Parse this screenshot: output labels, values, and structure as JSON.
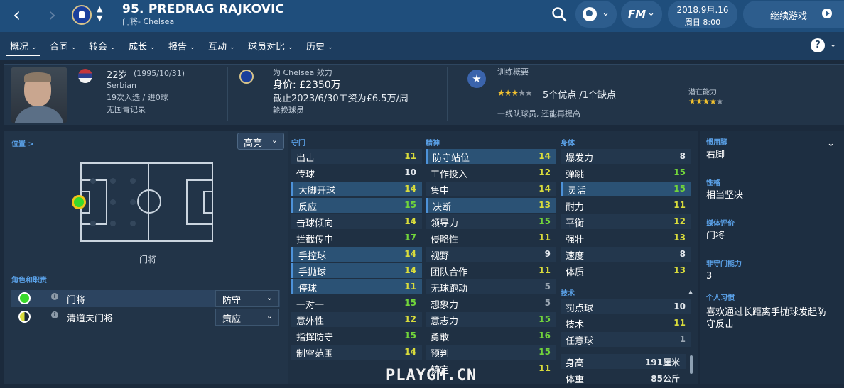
{
  "topbar": {
    "player_name": "95. PREDRAG RAJKOVIC",
    "subtitle": "门将- Chelsea",
    "date_line1": "2018.9月.16",
    "date_line2": "周日 8:00",
    "fm_label": "FM",
    "continue_label": "继续游戏"
  },
  "menu": [
    {
      "label": "概况"
    },
    {
      "label": "合同"
    },
    {
      "label": "转会"
    },
    {
      "label": "成长"
    },
    {
      "label": "报告"
    },
    {
      "label": "互动"
    },
    {
      "label": "球员对比"
    },
    {
      "label": "历史"
    }
  ],
  "info": {
    "age": "22岁",
    "dob": "(1995/10/31)",
    "nationality": "Serbian",
    "caps": "19次入选 / 进0球",
    "youth": "无国青记录",
    "plays_for": "为 Chelsea 效力",
    "value": "身价: £2350万",
    "contract": "截止2023/6/30工资为£6.5万/周",
    "squad_status": "轮换球员",
    "training_title": "训练概要",
    "strengths": "5个优点 /1个缺点",
    "training_note": "一线队球员, 还能再提高",
    "potential_title": "潜在能力",
    "current_stars": 3,
    "potential_stars": 4
  },
  "left": {
    "position_title": "位置 >",
    "highlight_label": "高亮",
    "pitch_label": "门将",
    "roles_title": "角色和职责",
    "roles": [
      {
        "name": "门将",
        "duty": "防守",
        "color": "#39d92b"
      },
      {
        "name": "清道夫门将",
        "duty": "策应",
        "color": "#d9dc3c"
      }
    ]
  },
  "sections": {
    "goalkeeping": "守门",
    "mental": "精神",
    "physical": "身体",
    "technical": "技术"
  },
  "goalkeeping": [
    {
      "label": "出击",
      "value": "11"
    },
    {
      "label": "传球",
      "value": "10"
    },
    {
      "label": "大脚开球",
      "value": "14"
    },
    {
      "label": "反应",
      "value": "15"
    },
    {
      "label": "击球倾向",
      "value": "14"
    },
    {
      "label": "拦截传中",
      "value": "17"
    },
    {
      "label": "手控球",
      "value": "14"
    },
    {
      "label": "手抛球",
      "value": "14"
    },
    {
      "label": "停球",
      "value": "11"
    },
    {
      "label": "一对一",
      "value": "15"
    },
    {
      "label": "意外性",
      "value": "12"
    },
    {
      "label": "指挥防守",
      "value": "15"
    },
    {
      "label": "制空范围",
      "value": "14"
    }
  ],
  "mental": [
    {
      "label": "防守站位",
      "value": "14"
    },
    {
      "label": "工作投入",
      "value": "12"
    },
    {
      "label": "集中",
      "value": "14"
    },
    {
      "label": "决断",
      "value": "13"
    },
    {
      "label": "领导力",
      "value": "15"
    },
    {
      "label": "侵略性",
      "value": "11"
    },
    {
      "label": "视野",
      "value": "9"
    },
    {
      "label": "团队合作",
      "value": "11"
    },
    {
      "label": "无球跑动",
      "value": "5"
    },
    {
      "label": "想象力",
      "value": "5"
    },
    {
      "label": "意志力",
      "value": "15"
    },
    {
      "label": "勇敢",
      "value": "16"
    },
    {
      "label": "预判",
      "value": "15"
    },
    {
      "label": "镇定",
      "value": "11"
    }
  ],
  "physical": [
    {
      "label": "爆发力",
      "value": "8"
    },
    {
      "label": "弹跳",
      "value": "15"
    },
    {
      "label": "灵活",
      "value": "15"
    },
    {
      "label": "耐力",
      "value": "11"
    },
    {
      "label": "平衡",
      "value": "12"
    },
    {
      "label": "强壮",
      "value": "13"
    },
    {
      "label": "速度",
      "value": "8"
    },
    {
      "label": "体质",
      "value": "13"
    }
  ],
  "technical": [
    {
      "label": "罚点球",
      "value": "10"
    },
    {
      "label": "技术",
      "value": "11"
    },
    {
      "label": "任意球",
      "value": "1"
    }
  ],
  "body": [
    {
      "label": "身高",
      "value": "191厘米"
    },
    {
      "label": "体重",
      "value": "85公斤"
    }
  ],
  "right": {
    "foot_title": "惯用脚",
    "foot": "右脚",
    "personality_title": "性格",
    "personality": "相当坚决",
    "media_title": "媒体评价",
    "media": "门将",
    "unnatural_title": "非守门能力",
    "unnatural": "3",
    "habits_title": "个人习惯",
    "habits": "喜欢通过长距离手抛球发起防守反击"
  },
  "watermark": "PLAYGM.CN",
  "colors": {
    "topbar": "#1f4e7c",
    "menubar": "#1d3d5f",
    "accent_blue": "#5aa0e6",
    "value_green": "#71d43b",
    "value_yellow": "#d9dc3c",
    "value_grey": "#9aa6b2"
  }
}
